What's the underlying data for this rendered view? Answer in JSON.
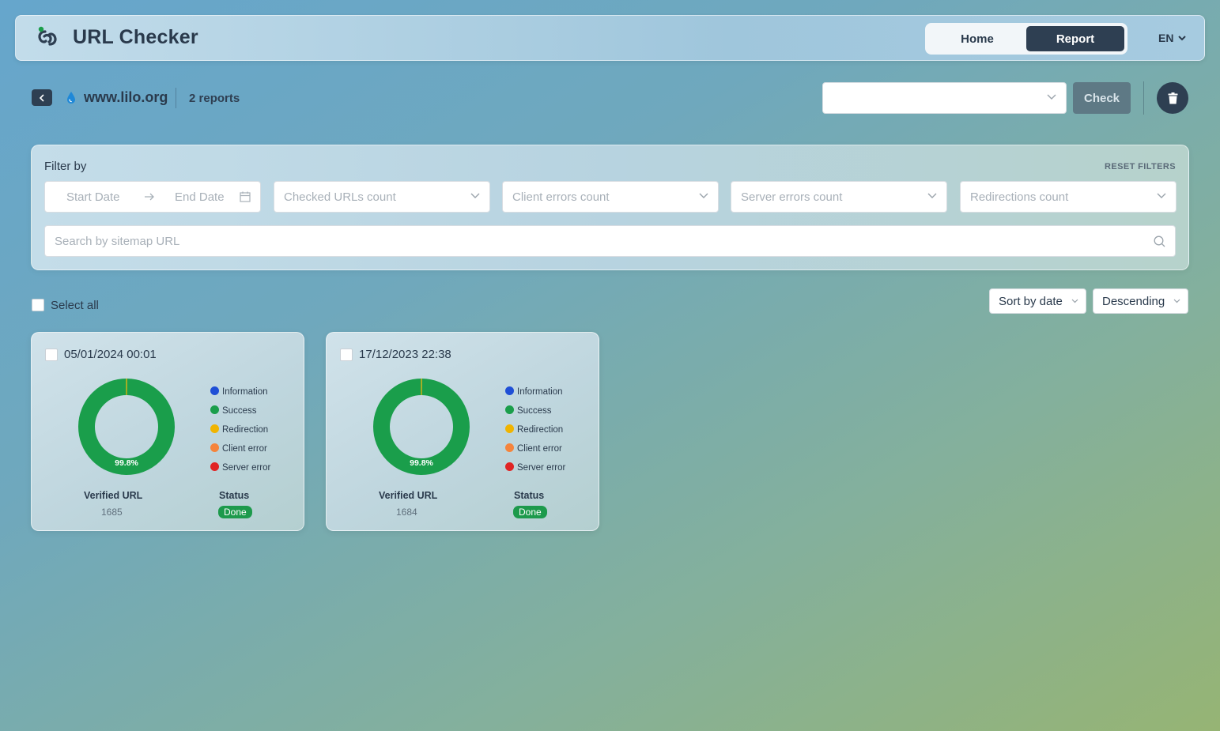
{
  "header": {
    "app_title": "URL Checker",
    "nav": [
      {
        "label": "Home",
        "active": false
      },
      {
        "label": "Report",
        "active": true
      }
    ],
    "language": "EN"
  },
  "site_bar": {
    "site": "www.lilo.org",
    "reports_count": "2 reports",
    "url_select_value": "",
    "check_label": "Check"
  },
  "filters": {
    "title": "Filter by",
    "reset_label": "RESET FILTERS",
    "start_date_placeholder": "Start Date",
    "end_date_placeholder": "End Date",
    "checked_urls_placeholder": "Checked URLs count",
    "client_errors_placeholder": "Client errors count",
    "server_errors_placeholder": "Server errors count",
    "redirections_placeholder": "Redirections count",
    "search_placeholder": "Search by sitemap URL"
  },
  "list": {
    "select_all_label": "Select all",
    "sort_by": "Sort by date",
    "order": "Descending"
  },
  "legend": [
    {
      "label": "Information",
      "color": "#1f4fd6"
    },
    {
      "label": "Success",
      "color": "#1a9e4b"
    },
    {
      "label": "Redirection",
      "color": "#f0b400"
    },
    {
      "label": "Client error",
      "color": "#f5843c"
    },
    {
      "label": "Server error",
      "color": "#e02424"
    }
  ],
  "reports": [
    {
      "date": "05/01/2024 00:01",
      "success_pct_label": "99.8%",
      "chart_data": {
        "type": "pie",
        "success": 99.8,
        "redirection": 0.2
      },
      "verified_label": "Verified URL",
      "verified_count": "1685",
      "status_label": "Status",
      "status": "Done"
    },
    {
      "date": "17/12/2023 22:38",
      "success_pct_label": "99.8%",
      "chart_data": {
        "type": "pie",
        "success": 99.8,
        "redirection": 0.2
      },
      "verified_label": "Verified URL",
      "verified_count": "1684",
      "status_label": "Status",
      "status": "Done"
    }
  ],
  "colors": {
    "dark_navy": "#2e3f52",
    "check_button": "#5e7985",
    "done_badge": "#1d9a4c"
  }
}
